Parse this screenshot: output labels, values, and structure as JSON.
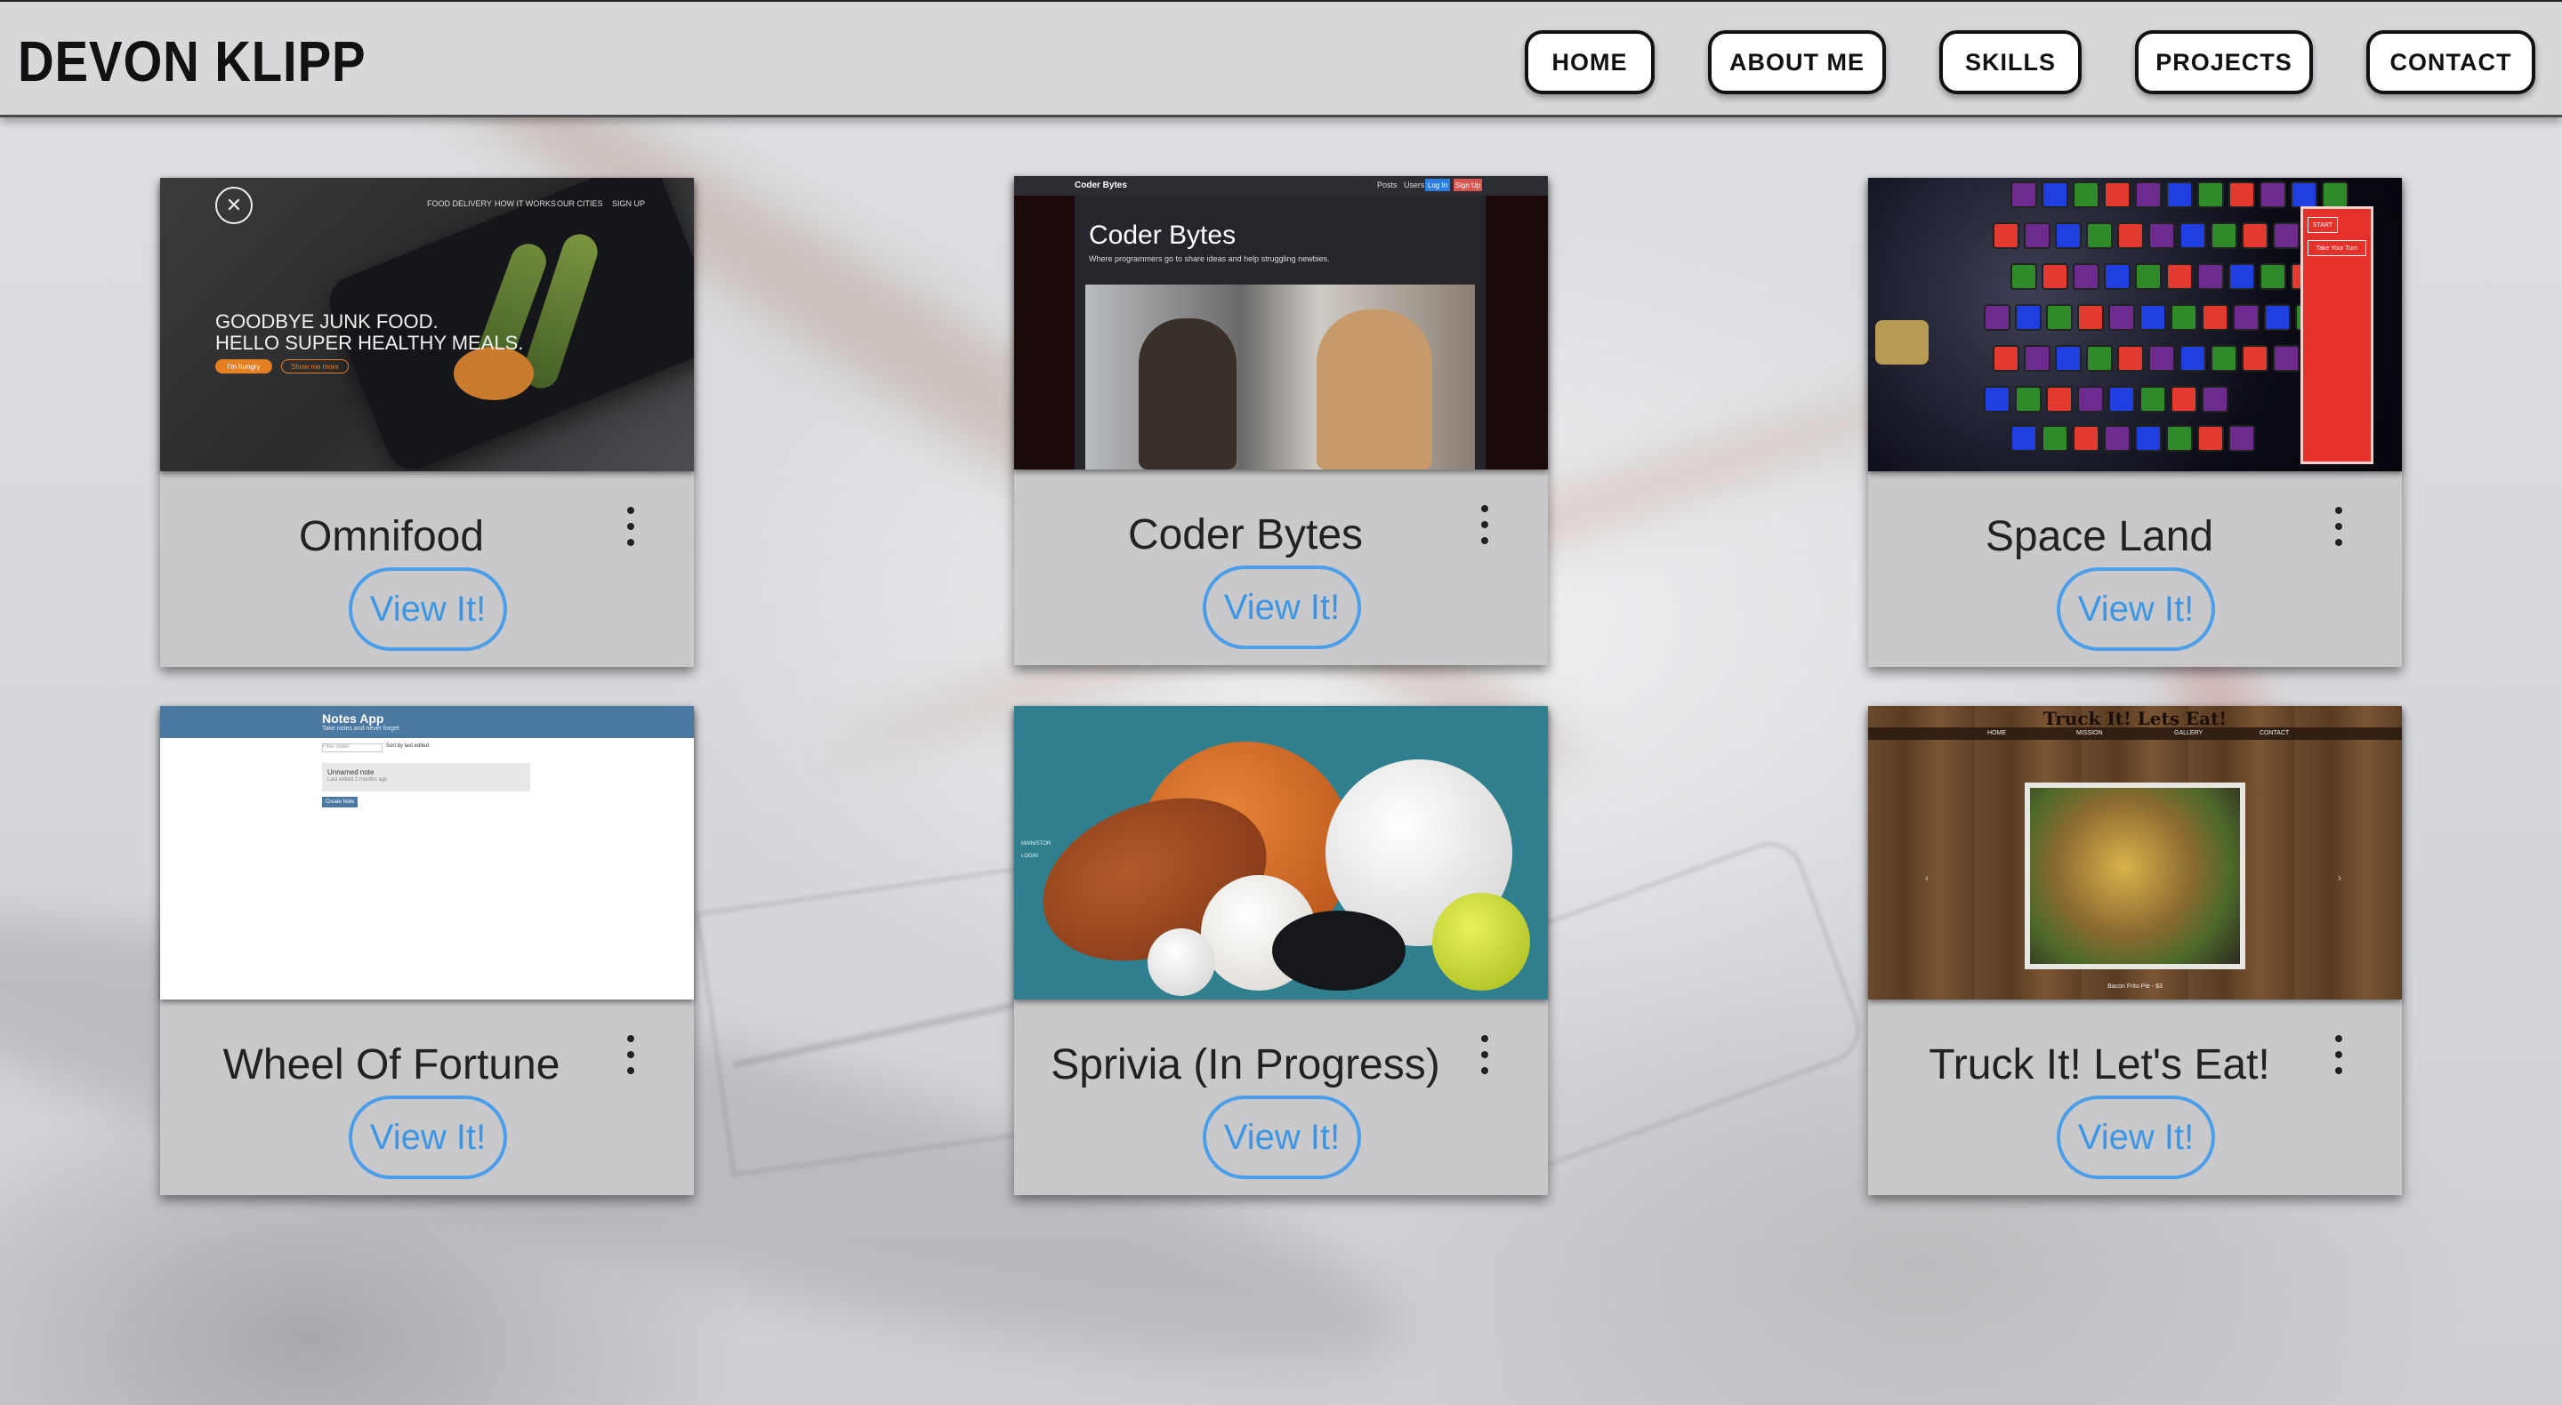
{
  "header": {
    "brand": "DEVON KLIPP",
    "nav": [
      "HOME",
      "ABOUT ME",
      "SKILLS",
      "PROJECTS",
      "CONTACT"
    ]
  },
  "colors": {
    "accent": "#4a9eea",
    "card_bg": "#c9c9cb",
    "header_bg": "#d8d8da"
  },
  "cards": [
    {
      "title": "Omnifood",
      "button": "View It!",
      "thumb": {
        "menu": [
          "FOOD DELIVERY",
          "HOW IT WORKS",
          "OUR CITIES",
          "SIGN UP"
        ],
        "headline_1": "GOODBYE JUNK FOOD.",
        "headline_2": "HELLO SUPER HEALTHY MEALS.",
        "cta_1": "I'm hungry",
        "cta_2": "Show me more"
      }
    },
    {
      "title": "Coder Bytes",
      "button": "View It!",
      "thumb": {
        "brand": "Coder Bytes",
        "nav": [
          "Posts",
          "Users"
        ],
        "login": "Log In",
        "signup": "Sign Up",
        "heading": "Coder Bytes",
        "tagline": "Where programmers go to share ideas and help struggling newbies."
      }
    },
    {
      "title": "Space Land",
      "button": "View It!",
      "thumb": {
        "start": "START",
        "take_turn": "Take Your Turn"
      }
    },
    {
      "title": "Wheel Of Fortune",
      "button": "View It!",
      "thumb": {
        "app_title": "Notes App",
        "app_subtitle": "Take notes and never forget",
        "filter_placeholder": "Filter notes",
        "sort": "Sort by last edited",
        "note_title": "Unnamed note",
        "note_meta": "Last edited 2 months ago",
        "create": "Create Note"
      }
    },
    {
      "title": "Sprivia (In Progress)",
      "button": "View It!",
      "thumb": {
        "side_1": "MAIN/STOR",
        "side_2": "LOGIN"
      }
    },
    {
      "title": "Truck It! Let's Eat!",
      "button": "View It!",
      "thumb": {
        "sign": "Truck It! Lets Eat!",
        "nav": [
          "HOME",
          "MISSION",
          "GALLERY",
          "CONTACT"
        ],
        "caption": "Bacon Frito Pie - $3"
      }
    }
  ]
}
